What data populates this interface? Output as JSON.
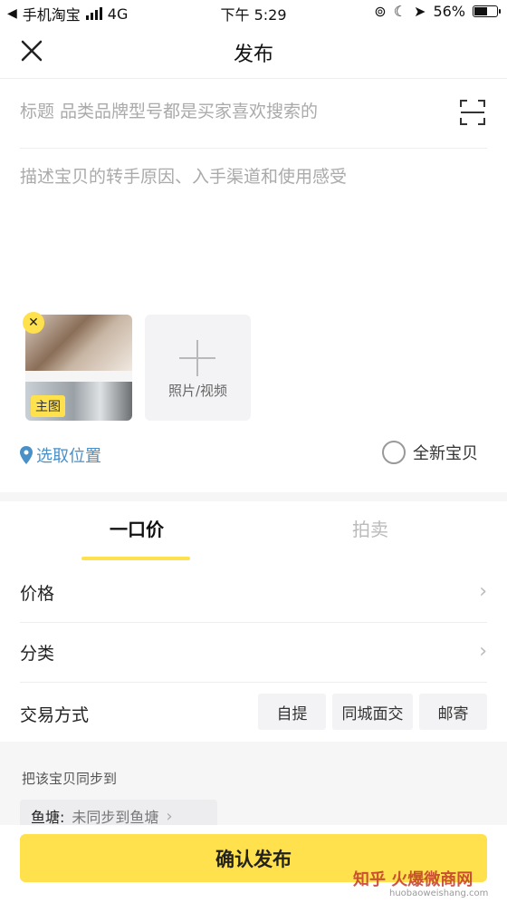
{
  "status_bar": {
    "carrier": "手机淘宝",
    "network": "4G",
    "time": "下午 5:29",
    "battery": "56%"
  },
  "header": {
    "title": "发布"
  },
  "form": {
    "title_placeholder": "标题 品类品牌型号都是买家喜欢搜索的",
    "description_placeholder": "描述宝贝的转手原因、入手渠道和使用感受"
  },
  "photos": {
    "main_tag": "主图",
    "add_label": "照片/视频"
  },
  "location": {
    "label": "选取位置"
  },
  "new_item": {
    "label": "全新宝贝"
  },
  "tabs": [
    {
      "label": "一口价"
    },
    {
      "label": "拍卖"
    }
  ],
  "rows": {
    "price": "价格",
    "category": "分类",
    "trade_method": "交易方式"
  },
  "trade_options": [
    "自提",
    "同城面交",
    "邮寄"
  ],
  "sync": {
    "title": "把该宝贝同步到",
    "key": "鱼塘:",
    "value": "未同步到鱼塘"
  },
  "confirm": {
    "label": "确认发布"
  },
  "watermark": {
    "text": "知乎 火爆微商网",
    "sub": "huobaoweishang.com"
  },
  "colors": {
    "accent": "#ffe14d",
    "link": "#4a90c8"
  }
}
